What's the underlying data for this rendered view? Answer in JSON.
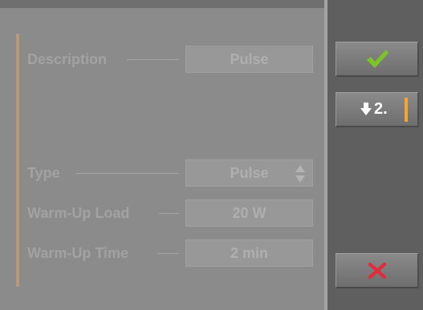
{
  "form": {
    "fields": [
      {
        "label": "Description",
        "value": "Pulse"
      },
      {
        "label": "Type",
        "value": "Pulse",
        "control": "select"
      },
      {
        "label": "Warm-Up Load",
        "value": "20 W"
      },
      {
        "label": "Warm-Up Time",
        "value": "2 min"
      }
    ]
  },
  "sidebar": {
    "confirm": {
      "icon": "checkmark-icon",
      "color": "#7cc528"
    },
    "next": {
      "label": "2.",
      "icon": "arrow-down-icon",
      "indicator_color": "#f2a531"
    },
    "cancel": {
      "icon": "close-icon",
      "color": "#e02d3b"
    }
  },
  "colors": {
    "panel": "#8b8b8b",
    "sidebar": "#5f5f5f",
    "accent": "#b7997a"
  }
}
